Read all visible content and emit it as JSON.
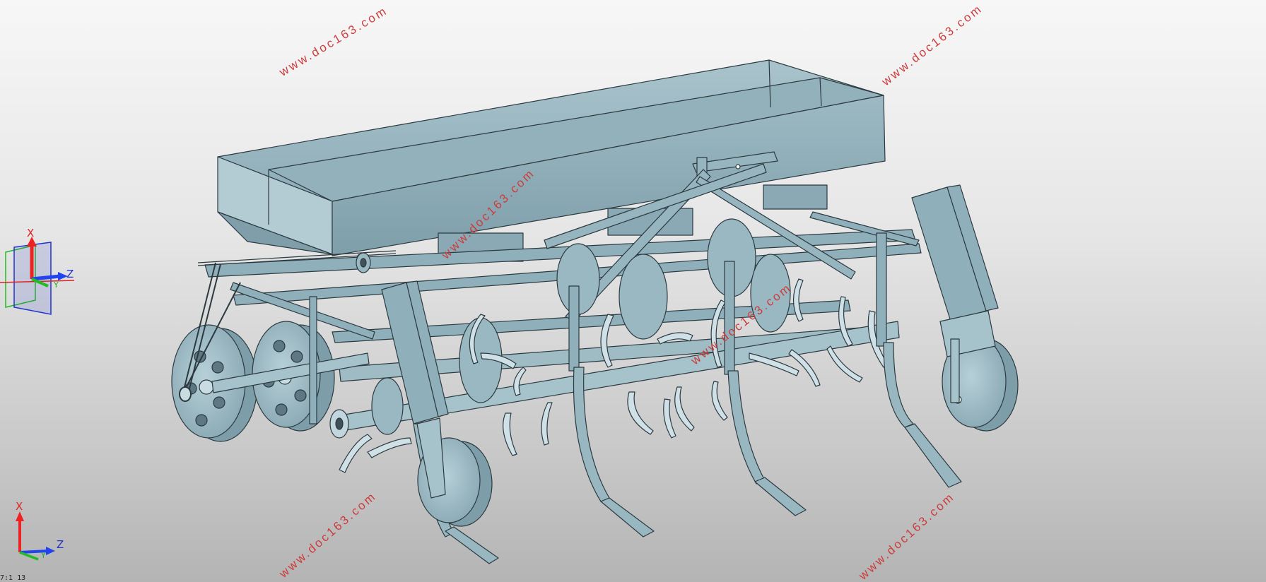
{
  "viewport": {
    "background_top": "#f7f7f7",
    "background_bottom": "#b4b4b4",
    "model_color": "#8aacb8",
    "edge_color": "#2c3a40",
    "watermark_color": "#cd3c3c"
  },
  "watermarks": [
    "www.doc163.com",
    "www.doc163.com",
    "www.doc163.com",
    "www.doc163.com",
    "www.doc163.com",
    "www.doc163.com",
    "www.doc163.com"
  ],
  "view_triad": {
    "x_label": "X",
    "z_label": "Z",
    "y_label": "Y"
  },
  "origin_triad": {
    "x_label": "X",
    "z_label": "Z",
    "y_label": "Y"
  },
  "status_corner": "7:1 13"
}
